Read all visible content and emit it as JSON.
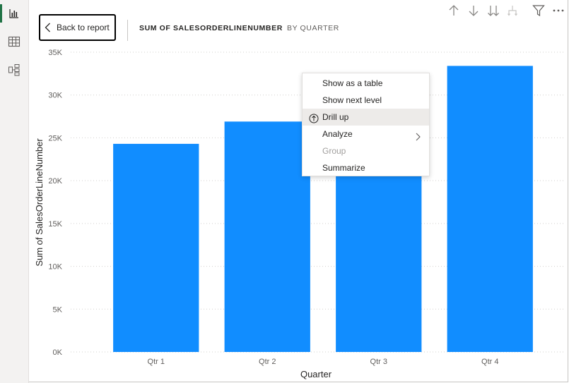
{
  "nav": {
    "items": [
      "report-view",
      "data-view",
      "model-view"
    ]
  },
  "header": {
    "back_label": "Back to report",
    "title_field": "SUM OF SALESORDERLINENUMBER",
    "title_by": "BY QUARTER"
  },
  "toolbar": {
    "icons": [
      "drill-up-arrow",
      "drill-down-arrow",
      "expand-all-down-arrows",
      "expand-hierarchy",
      "filter",
      "more-options"
    ]
  },
  "colors": {
    "bar": "#118dff",
    "accent": "#217346"
  },
  "chart_data": {
    "type": "bar",
    "categories": [
      "Qtr 1",
      "Qtr 2",
      "Qtr 3",
      "Qtr 4"
    ],
    "values": [
      24300,
      26900,
      21000,
      33400
    ],
    "xlabel": "Quarter",
    "ylabel": "Sum of SalesOrderLineNumber",
    "ylim": [
      0,
      35000
    ],
    "yticks": [
      "0K",
      "5K",
      "10K",
      "15K",
      "20K",
      "25K",
      "30K",
      "35K"
    ],
    "grid": true
  },
  "context_menu": {
    "items": [
      {
        "label": "Show as a table",
        "state": "normal"
      },
      {
        "label": "Show next level",
        "state": "normal"
      },
      {
        "label": "Drill up",
        "state": "highlighted",
        "icon": "up-arrow-circle"
      },
      {
        "label": "Analyze",
        "state": "normal",
        "submenu": true
      },
      {
        "label": "Group",
        "state": "disabled"
      },
      {
        "label": "Summarize",
        "state": "normal"
      }
    ]
  }
}
